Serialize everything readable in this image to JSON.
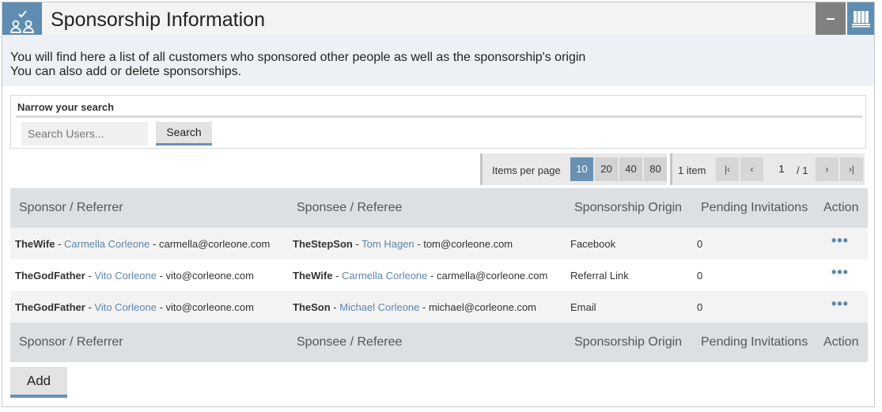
{
  "header": {
    "title": "Sponsorship Information",
    "icon": "sponsorship-check-people-icon",
    "accent_color": "#5f8cb1"
  },
  "description": {
    "line1": "You will find here a list of all customers who sponsored other people as well as the sponsorship's origin",
    "line2": "You can also add or delete sponsorships."
  },
  "search": {
    "title": "Narrow your search",
    "placeholder": "Search Users...",
    "value": "",
    "button_label": "Search"
  },
  "pagination": {
    "items_per_page_label": "Items per page",
    "options": [
      "10",
      "20",
      "40",
      "80"
    ],
    "selected": "10",
    "item_count": "1 item",
    "current_page": "1",
    "total_pages": "/ 1",
    "first_label": "|‹",
    "prev_label": "‹",
    "next_label": "›",
    "last_label": "›|"
  },
  "table": {
    "columns": [
      "Sponsor / Referrer",
      "Sponsee / Referee",
      "Sponsorship Origin",
      "Pending Invitations",
      "Action"
    ],
    "rows": [
      {
        "sponsor_user": "TheWife",
        "sponsor_name": "Carmella Corleone",
        "sponsor_email": "carmella@corleone.com",
        "sponsee_user": "TheStepSon",
        "sponsee_name": "Tom Hagen",
        "sponsee_email": "tom@corleone.com",
        "origin": "Facebook",
        "pending": "0"
      },
      {
        "sponsor_user": "TheGodFather",
        "sponsor_name": "Vito Corleone",
        "sponsor_email": "vito@corleone.com",
        "sponsee_user": "TheWife",
        "sponsee_name": "Carmella Corleone",
        "sponsee_email": "carmella@corleone.com",
        "origin": "Referral Link",
        "pending": "0"
      },
      {
        "sponsor_user": "TheGodFather",
        "sponsor_name": "Vito Corleone",
        "sponsor_email": "vito@corleone.com",
        "sponsee_user": "TheSon",
        "sponsee_name": "Michael Corleone",
        "sponsee_email": "michael@corleone.com",
        "origin": "Email",
        "pending": "0"
      }
    ],
    "separator": " - ",
    "action_label": "•••"
  },
  "add_button_label": "Add"
}
